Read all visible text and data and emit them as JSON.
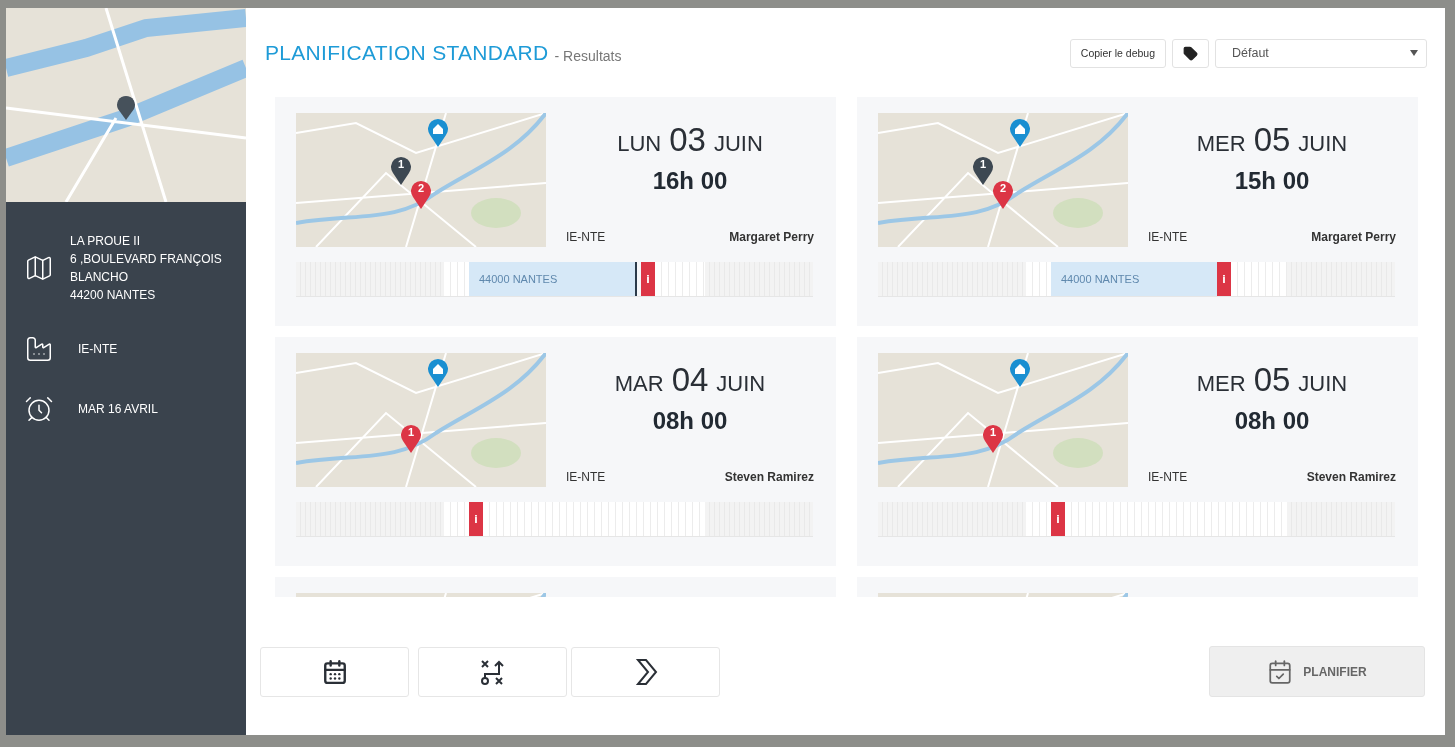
{
  "sidebar": {
    "address_lines": [
      "LA PROUE II",
      "6 ,BOULEVARD FRANÇOIS",
      "BLANCHO",
      "44200 NANTES"
    ],
    "agency": "IE-NTE",
    "date": "MAR 16 AVRIL"
  },
  "header": {
    "title": "PLANIFICATION STANDARD",
    "subtitle": "- Resultats",
    "debug_button": "Copier le debug",
    "select": {
      "value": "Défaut"
    }
  },
  "cards": [
    {
      "kind": "full",
      "weekday": "LUN",
      "day": "03",
      "month": "JUIN",
      "time": "16h 00",
      "agency": "IE-NTE",
      "technician": "Margaret Perry",
      "pins": [
        {
          "kind": "home",
          "color": "#1a8fd1"
        },
        {
          "kind": "stop",
          "label": "1",
          "color": "#3d4852"
        },
        {
          "kind": "stop",
          "label": "2",
          "color": "#dc3545"
        }
      ],
      "timeline": {
        "booking": "44000 NANTES",
        "cursor": true,
        "alert": "i"
      }
    },
    {
      "kind": "full",
      "weekday": "MER",
      "day": "05",
      "month": "JUIN",
      "time": "15h 00",
      "agency": "IE-NTE",
      "technician": "Margaret Perry",
      "pins": [
        {
          "kind": "home",
          "color": "#1a8fd1"
        },
        {
          "kind": "stop",
          "label": "1",
          "color": "#3d4852"
        },
        {
          "kind": "stop",
          "label": "2",
          "color": "#dc3545"
        }
      ],
      "timeline": {
        "booking": "44000 NANTES",
        "cursor": false,
        "alert": "i"
      }
    },
    {
      "kind": "full",
      "weekday": "MAR",
      "day": "04",
      "month": "JUIN",
      "time": "08h 00",
      "agency": "IE-NTE",
      "technician": "Steven Ramirez",
      "pins": [
        {
          "kind": "home",
          "color": "#1a8fd1"
        },
        {
          "kind": "stop",
          "label": "1",
          "color": "#dc3545"
        }
      ],
      "timeline": {
        "cursor": false,
        "alert": "i"
      }
    },
    {
      "kind": "full",
      "weekday": "MER",
      "day": "05",
      "month": "JUIN",
      "time": "08h 00",
      "agency": "IE-NTE",
      "technician": "Steven Ramirez",
      "pins": [
        {
          "kind": "home",
          "color": "#1a8fd1"
        },
        {
          "kind": "stop",
          "label": "1",
          "color": "#dc3545"
        }
      ],
      "timeline": {
        "cursor": false,
        "alert": "i"
      }
    },
    {
      "kind": "cut"
    },
    {
      "kind": "cut"
    }
  ],
  "footer": {
    "plan_button": {
      "label": "PLANIFIER",
      "disabled": true
    }
  }
}
